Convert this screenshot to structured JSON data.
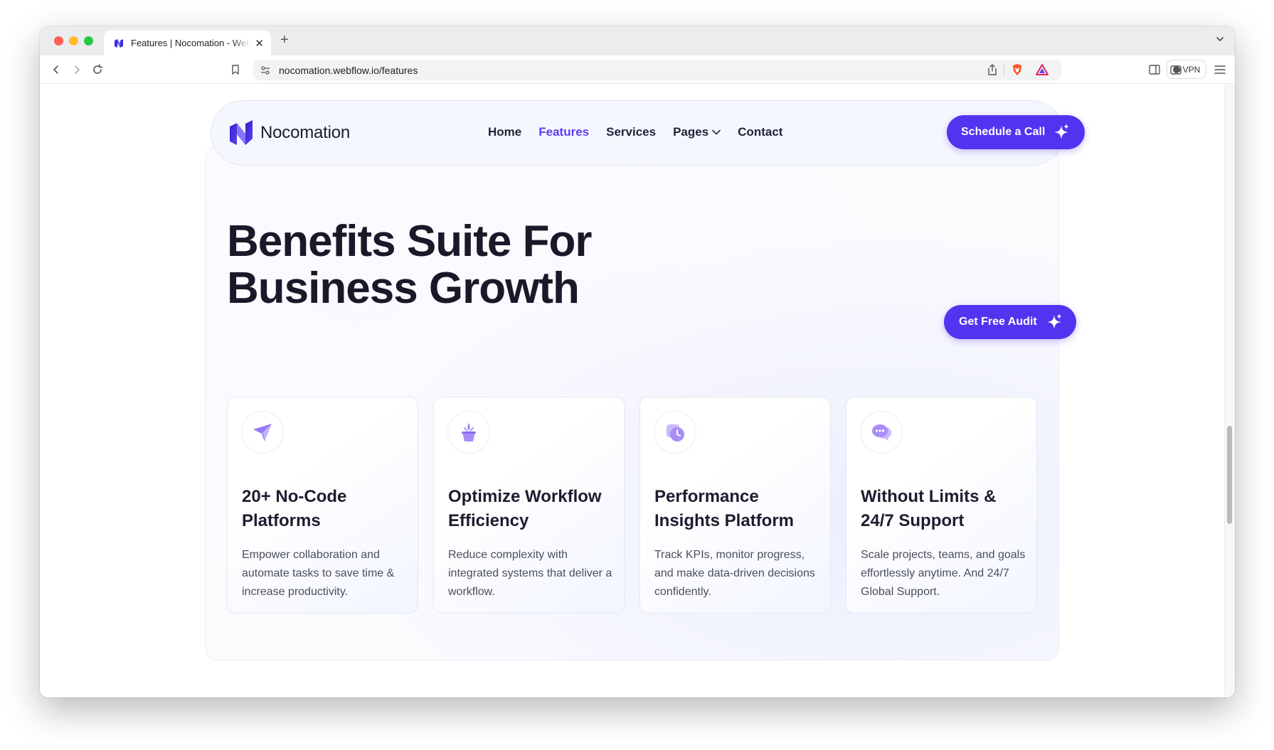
{
  "browser": {
    "tab_title": "Features | Nocomation - Webflow Template",
    "url": "nocomation.webflow.io/features",
    "vpn_label": "VPN"
  },
  "nav": {
    "brand": "Nocomation",
    "links": [
      "Home",
      "Features",
      "Services",
      "Pages",
      "Contact"
    ],
    "active_link": "Features",
    "cta_label": "Schedule a Call"
  },
  "hero": {
    "headline_line1": "Benefits Suite For",
    "headline_line2": "Business Growth",
    "cta_label": "Get Free Audit"
  },
  "cards": [
    {
      "icon": "paper-plane-icon",
      "title": "20+ No-Code Platforms",
      "text": "Empower collaboration and automate tasks to save time & increase productivity."
    },
    {
      "icon": "plant-pot-icon",
      "title": "Optimize Workflow Efficiency",
      "text": "Reduce complexity with integrated systems that deliver a workflow."
    },
    {
      "icon": "clock-calendar-icon",
      "title": "Performance Insights Platform",
      "text": "Track KPIs, monitor progress, and make data-driven decisions confidently."
    },
    {
      "icon": "chat-bubble-icon",
      "title": "Without Limits & 24/7 Support",
      "text": "Scale projects, teams, and goals effortlessly anytime. And 24/7 Global Support."
    }
  ],
  "colors": {
    "accent": "#5433f0",
    "active_nav": "#5b3df5",
    "heading": "#191929",
    "body_text": "#4b4d5e",
    "icon_lavender": "#a98cf5"
  }
}
